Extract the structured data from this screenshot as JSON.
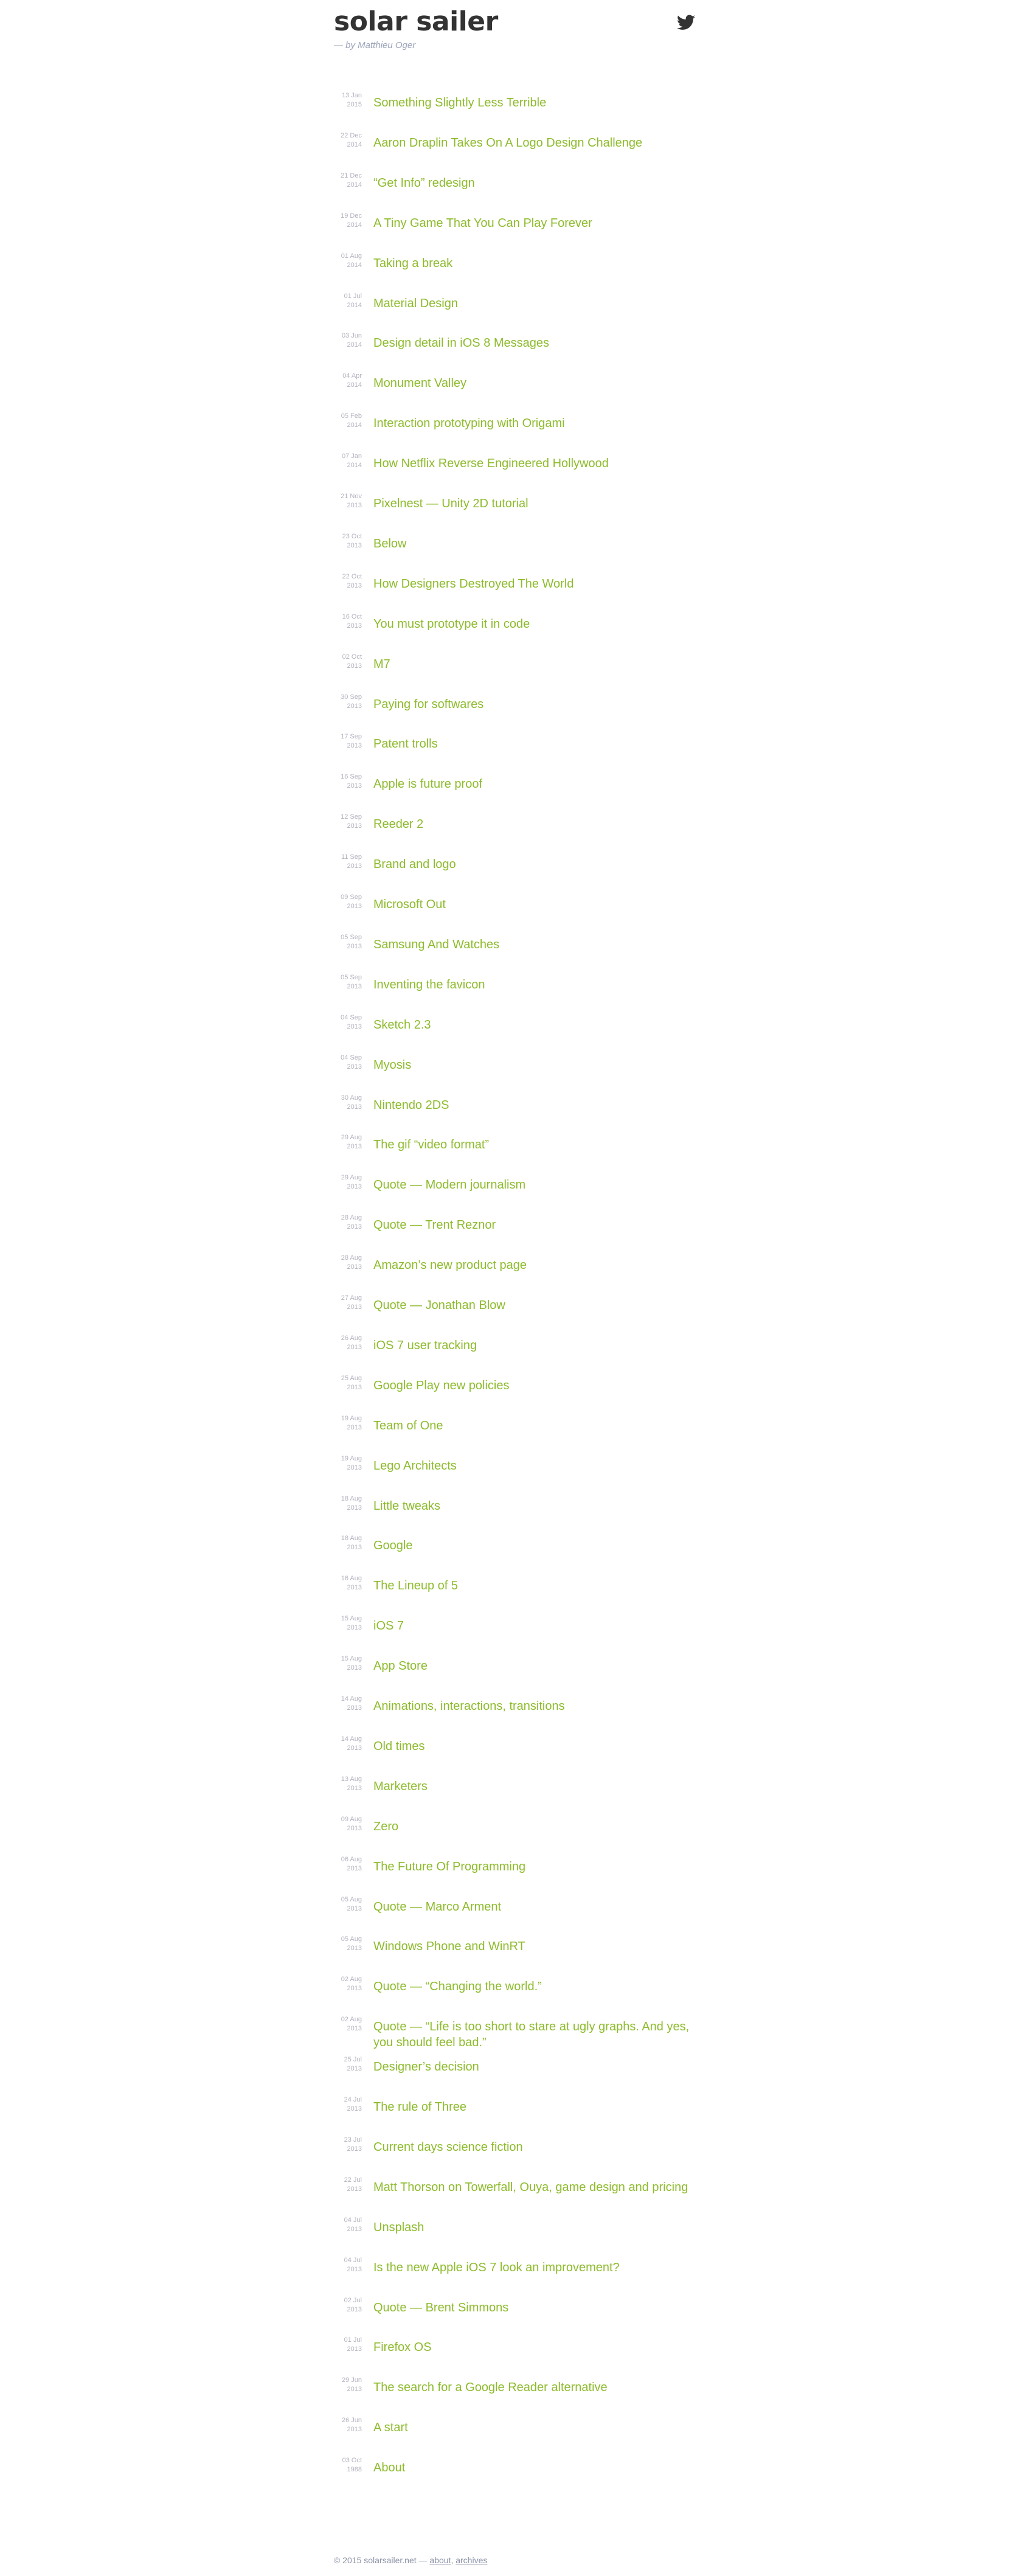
{
  "header": {
    "site_title": "solar sailer",
    "byline": "— by Matthieu Oger",
    "twitter_icon": "twitter-bird-icon"
  },
  "colors": {
    "title_text": "#333333",
    "link_green": "#8dbb2c",
    "date_grey": "#b3b3bf",
    "byline_grey": "#9aa3b8"
  },
  "posts": [
    {
      "day": "13 Jan",
      "year": "2015",
      "title": "Something Slightly Less Terrible"
    },
    {
      "day": "22 Dec",
      "year": "2014",
      "title": "Aaron Draplin Takes On A Logo Design Challenge"
    },
    {
      "day": "21 Dec",
      "year": "2014",
      "title": "“Get Info” redesign"
    },
    {
      "day": "19 Dec",
      "year": "2014",
      "title": "A Tiny Game That You Can Play Forever"
    },
    {
      "day": "01 Aug",
      "year": "2014",
      "title": "Taking a break"
    },
    {
      "day": "01 Jul",
      "year": "2014",
      "title": "Material Design"
    },
    {
      "day": "03 Jun",
      "year": "2014",
      "title": "Design detail in iOS 8 Messages"
    },
    {
      "day": "04 Apr",
      "year": "2014",
      "title": "Monument Valley"
    },
    {
      "day": "05 Feb",
      "year": "2014",
      "title": "Interaction prototyping with Origami"
    },
    {
      "day": "07 Jan",
      "year": "2014",
      "title": "How Netflix Reverse Engineered Hollywood"
    },
    {
      "day": "21 Nov",
      "year": "2013",
      "title": "Pixelnest — Unity 2D tutorial"
    },
    {
      "day": "23 Oct",
      "year": "2013",
      "title": "Below"
    },
    {
      "day": "22 Oct",
      "year": "2013",
      "title": "How Designers Destroyed The World"
    },
    {
      "day": "16 Oct",
      "year": "2013",
      "title": "You must prototype it in code"
    },
    {
      "day": "02 Oct",
      "year": "2013",
      "title": "M7"
    },
    {
      "day": "30 Sep",
      "year": "2013",
      "title": "Paying for softwares"
    },
    {
      "day": "17 Sep",
      "year": "2013",
      "title": "Patent trolls"
    },
    {
      "day": "16 Sep",
      "year": "2013",
      "title": "Apple is future proof"
    },
    {
      "day": "12 Sep",
      "year": "2013",
      "title": "Reeder 2"
    },
    {
      "day": "11 Sep",
      "year": "2013",
      "title": "Brand and logo"
    },
    {
      "day": "09 Sep",
      "year": "2013",
      "title": "Microsoft Out"
    },
    {
      "day": "05 Sep",
      "year": "2013",
      "title": "Samsung And Watches"
    },
    {
      "day": "05 Sep",
      "year": "2013",
      "title": "Inventing the favicon"
    },
    {
      "day": "04 Sep",
      "year": "2013",
      "title": "Sketch 2.3"
    },
    {
      "day": "04 Sep",
      "year": "2013",
      "title": "Myosis"
    },
    {
      "day": "30 Aug",
      "year": "2013",
      "title": "Nintendo 2DS"
    },
    {
      "day": "29 Aug",
      "year": "2013",
      "title": "The gif “video format”"
    },
    {
      "day": "29 Aug",
      "year": "2013",
      "title": "Quote — Modern journalism"
    },
    {
      "day": "28 Aug",
      "year": "2013",
      "title": "Quote — Trent Reznor"
    },
    {
      "day": "28 Aug",
      "year": "2013",
      "title": "Amazon’s new product page"
    },
    {
      "day": "27 Aug",
      "year": "2013",
      "title": "Quote — Jonathan Blow"
    },
    {
      "day": "26 Aug",
      "year": "2013",
      "title": "iOS 7 user tracking"
    },
    {
      "day": "25 Aug",
      "year": "2013",
      "title": "Google Play new policies"
    },
    {
      "day": "19 Aug",
      "year": "2013",
      "title": "Team of One"
    },
    {
      "day": "19 Aug",
      "year": "2013",
      "title": "Lego Architects"
    },
    {
      "day": "18 Aug",
      "year": "2013",
      "title": "Little tweaks"
    },
    {
      "day": "18 Aug",
      "year": "2013",
      "title": "Google"
    },
    {
      "day": "16 Aug",
      "year": "2013",
      "title": "The Lineup of 5"
    },
    {
      "day": "15 Aug",
      "year": "2013",
      "title": "iOS 7"
    },
    {
      "day": "15 Aug",
      "year": "2013",
      "title": "App Store"
    },
    {
      "day": "14 Aug",
      "year": "2013",
      "title": "Animations, interactions, transitions"
    },
    {
      "day": "14 Aug",
      "year": "2013",
      "title": "Old times"
    },
    {
      "day": "13 Aug",
      "year": "2013",
      "title": "Marketers"
    },
    {
      "day": "09 Aug",
      "year": "2013",
      "title": "Zero"
    },
    {
      "day": "06 Aug",
      "year": "2013",
      "title": "The Future Of Programming"
    },
    {
      "day": "05 Aug",
      "year": "2013",
      "title": "Quote — Marco Arment"
    },
    {
      "day": "05 Aug",
      "year": "2013",
      "title": "Windows Phone and WinRT"
    },
    {
      "day": "02 Aug",
      "year": "2013",
      "title": "Quote — “Changing the world.”"
    },
    {
      "day": "02 Aug",
      "year": "2013",
      "title": "Quote — “Life is too short to stare at ugly graphs. And yes, you should feel bad.”"
    },
    {
      "day": "25 Jul",
      "year": "2013",
      "title": "Designer’s decision"
    },
    {
      "day": "24 Jul",
      "year": "2013",
      "title": "The rule of Three"
    },
    {
      "day": "23 Jul",
      "year": "2013",
      "title": "Current days science fiction"
    },
    {
      "day": "22 Jul",
      "year": "2013",
      "title": "Matt Thorson on Towerfall, Ouya, game design and pricing"
    },
    {
      "day": "04 Jul",
      "year": "2013",
      "title": "Unsplash"
    },
    {
      "day": "04 Jul",
      "year": "2013",
      "title": "Is the new Apple iOS 7 look an improvement?"
    },
    {
      "day": "02 Jul",
      "year": "2013",
      "title": "Quote — Brent Simmons"
    },
    {
      "day": "01 Jul",
      "year": "2013",
      "title": "Firefox OS"
    },
    {
      "day": "29 Jun",
      "year": "2013",
      "title": "The search for a Google Reader alternative"
    },
    {
      "day": "26 Jun",
      "year": "2013",
      "title": "A start"
    },
    {
      "day": "03 Oct",
      "year": "1988",
      "title": "About"
    }
  ],
  "footer": {
    "copyright": "© 2015 solarsailer.net — ",
    "about_link": "about",
    "separator": ", ",
    "archives_link": "archives"
  }
}
